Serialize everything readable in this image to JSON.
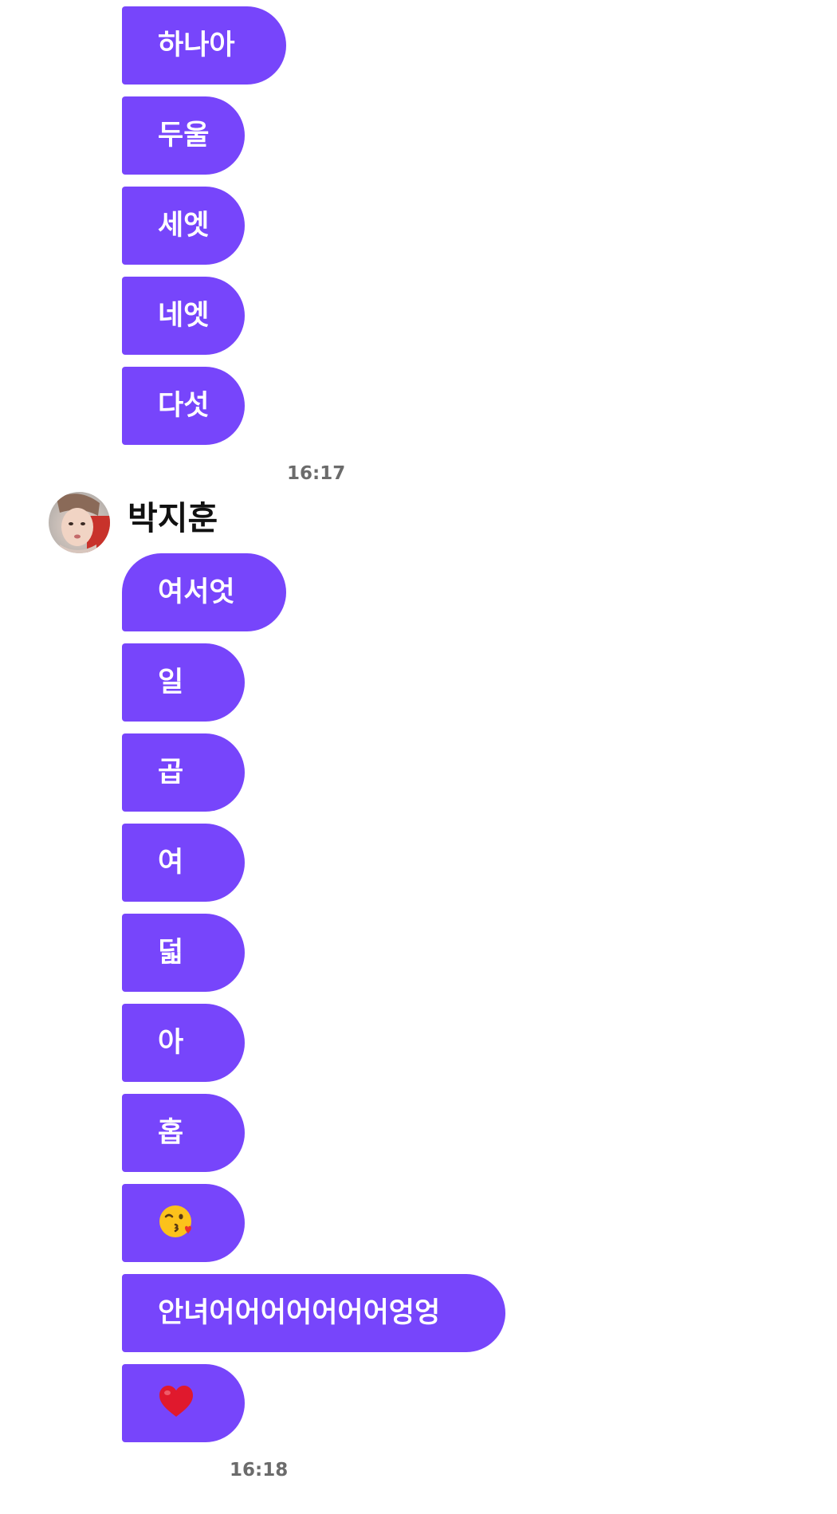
{
  "colors": {
    "bubble": "#7745fb",
    "bubble_text": "#ffffff",
    "timestamp": "#6b6b6b",
    "name": "#111111"
  },
  "group1": {
    "messages": [
      "하나아",
      "두울",
      "세엣",
      "네엣",
      "다섯"
    ],
    "time": "16:17"
  },
  "group2": {
    "sender": {
      "name": "박지훈",
      "avatar": "avatar-photo"
    },
    "messages": [
      {
        "text": "여서엇"
      },
      {
        "text": "일"
      },
      {
        "text": "곱"
      },
      {
        "text": "여"
      },
      {
        "text": "덟"
      },
      {
        "text": "아"
      },
      {
        "text": "홉"
      },
      {
        "emoji": "kissing-face-emoji"
      },
      {
        "text": "안녀어어어어어어어엉엉"
      },
      {
        "emoji": "red-heart-emoji"
      }
    ],
    "time": "16:18"
  }
}
